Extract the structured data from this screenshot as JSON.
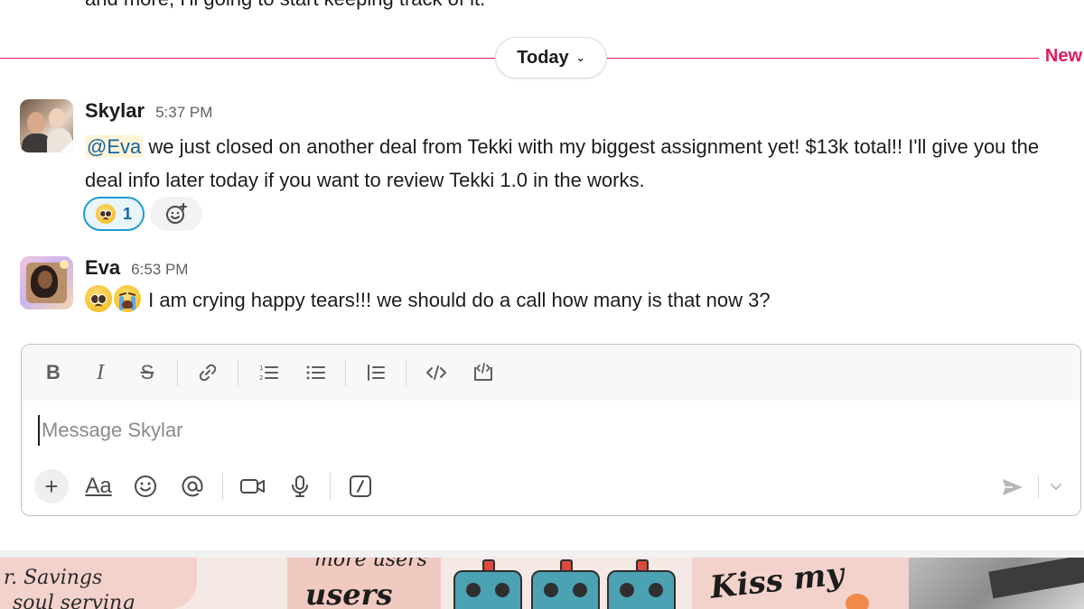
{
  "previous_message": {
    "text": "and more, I'll going to start keeping track of it."
  },
  "divider": {
    "day_label": "Today",
    "chevron": "⌄",
    "new_label": "New"
  },
  "messages": [
    {
      "sender": "Skylar",
      "time": "5:37 PM",
      "mention": "@Eva",
      "text": " we just closed on another deal from Tekki with my biggest assignment yet! $13k total!! I'll give you the deal info later today if you want to review Tekki 1.0 in the works.",
      "reactions": [
        {
          "emoji": "pleading-face-emoji",
          "count": "1"
        }
      ]
    },
    {
      "sender": "Eva",
      "time": "6:53 PM",
      "text": " I am crying happy tears!!! we should do a call how many is that now 3?"
    }
  ],
  "composer": {
    "placeholder": "Message Skylar",
    "value": "",
    "format_toolbar": {
      "bold": "B",
      "italic": "I",
      "strike": "S"
    },
    "actions": {
      "plus": "+",
      "text_format": "Aa"
    }
  },
  "background_stickers": {
    "savings_line1": "r. Savings",
    "savings_line2": "soul serving",
    "users_top": "more users",
    "users": "users",
    "kiss": "Kiss my"
  },
  "colors": {
    "new_divider": "#e01e5a",
    "mention_bg": "#fff4d6",
    "mention_text": "#1264a3",
    "reaction_border": "#1d9bd1",
    "reaction_bg": "#e8f5fa"
  }
}
